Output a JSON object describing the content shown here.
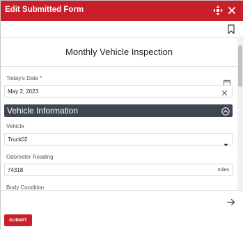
{
  "dialog": {
    "title": "Edit Submitted Form"
  },
  "form": {
    "title": "Monthly Vehicle Inspection",
    "date_label": "Today's Date *",
    "date_value": "May 2, 2023",
    "section_title": "Vehicle Information",
    "vehicle_label": "Vehicle",
    "vehicle_value": "Truck02",
    "odometer_label": "Odometer Reading",
    "odometer_value": "74318",
    "odometer_unit": "miles",
    "body_condition_label": "Body Condition"
  },
  "footer": {
    "submit_label": "SUBMIT"
  },
  "colors": {
    "brand": "#c81f2a",
    "section_bg": "#3f4553"
  },
  "icons": {
    "move": "move-arrows-icon",
    "close": "close-icon",
    "bookmark": "bookmark-icon",
    "calendar": "calendar-icon",
    "clear": "clear-icon",
    "collapse": "chevron-up-icon",
    "dropdown": "caret-down-icon",
    "next": "arrow-right-icon"
  }
}
